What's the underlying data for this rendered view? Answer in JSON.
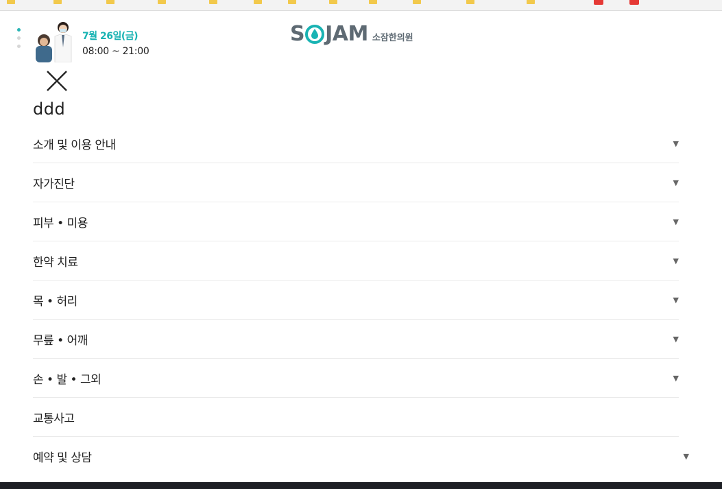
{
  "sidebar_dots": 3,
  "header": {
    "date": "7월 26일(금)",
    "hours": "08:00 ~ 21:00",
    "logo_text_left": "S",
    "logo_text_right": "JAM",
    "logo_korean": "소잠한의원",
    "colors": {
      "accent": "#19b3b3",
      "logo": "#5e6a73"
    }
  },
  "menu": {
    "title": "ddd",
    "close_icon": "close-icon",
    "items": [
      {
        "label": "소개 및 이용 안내",
        "has_arrow": true
      },
      {
        "label": "자가진단",
        "has_arrow": true
      },
      {
        "label": "피부 • 미용",
        "has_arrow": true
      },
      {
        "label": "한약 치료",
        "has_arrow": true
      },
      {
        "label": "목 • 허리",
        "has_arrow": true
      },
      {
        "label": "무릎 • 어깨",
        "has_arrow": true
      },
      {
        "label": "손 • 발 • 그외",
        "has_arrow": true
      },
      {
        "label": "교통사고",
        "has_arrow": false
      },
      {
        "label": "예약 및 상담",
        "has_arrow": true
      }
    ],
    "arrow_glyph": "▼"
  }
}
